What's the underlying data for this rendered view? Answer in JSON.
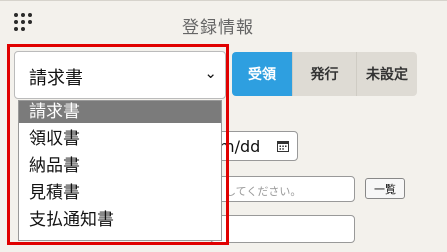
{
  "header": {
    "title": "登録情報"
  },
  "icons": {
    "drag_handle": "drag-dots-icon",
    "calendar": "calendar-icon",
    "chevron": "chevron-down-icon"
  },
  "document_type_select": {
    "selected": "請求書",
    "options": [
      "請求書",
      "領収書",
      "納品書",
      "見積書",
      "支払通知書"
    ]
  },
  "status_segments": [
    {
      "label": "受領",
      "active": true
    },
    {
      "label": "発行",
      "active": false
    },
    {
      "label": "未設定",
      "active": false
    }
  ],
  "date_field": {
    "visible_text": "m/dd"
  },
  "search_field": {
    "placeholder": "してください。"
  },
  "list_button": {
    "label": "一覧"
  },
  "colors": {
    "active_segment": "#2e9fe0",
    "highlight_border": "#e00000",
    "selected_option_bg": "#7b7b7b"
  }
}
